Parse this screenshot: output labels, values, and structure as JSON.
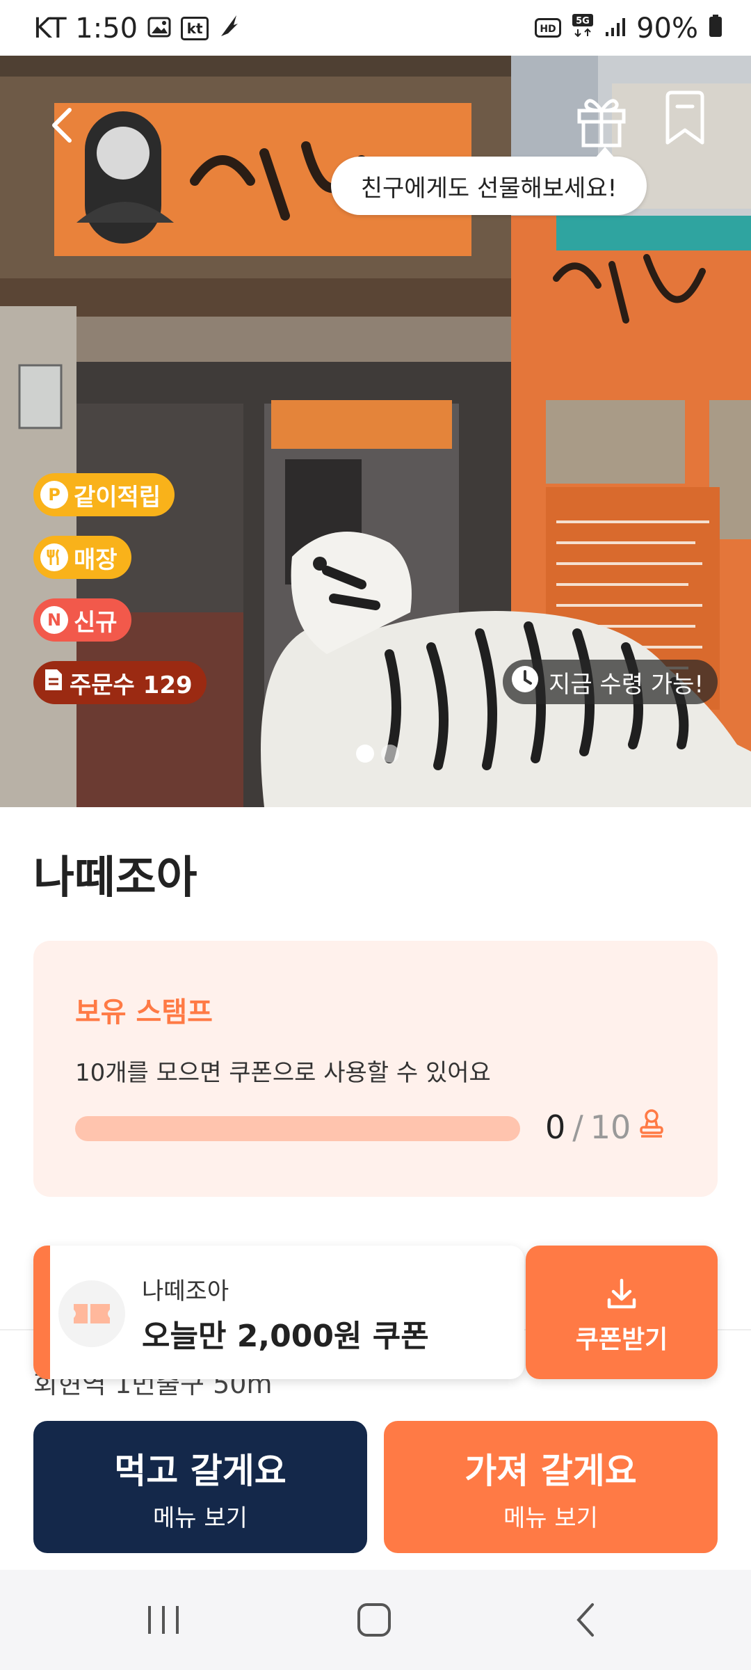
{
  "status_bar": {
    "carrier_time": "KT 1:50",
    "kt_badge": "kt",
    "battery": "90%",
    "icons": [
      "image-icon",
      "kt-icon",
      "feather-icon",
      "hd-icon",
      "5g-icon",
      "signal-icon",
      "battery-icon"
    ]
  },
  "hero": {
    "tooltip": "친구에게도 선물해보세요!",
    "chips": {
      "pickup": "같이적립",
      "store": "매장",
      "new": "신규",
      "orders": "주문수 129"
    },
    "chip_icons": {
      "pickup": "P",
      "new": "N"
    },
    "pickup_now": "지금 수령 가능!",
    "slide_index": 1,
    "slide_total": 2
  },
  "store": {
    "name": "나떼조아"
  },
  "stamp": {
    "heading": "보유 스탬프",
    "description": "10개를 모으면 쿠폰으로 사용할 수 있어요",
    "current": "0",
    "separator": "/",
    "total": "10",
    "progress": 0
  },
  "coupon": {
    "store_name": "나떼조아",
    "title": "오늘만 2,000원 쿠폰",
    "button_label": "쿠폰받기"
  },
  "distance_text": "회현역 1번출구 50m",
  "actions": {
    "eat_in": {
      "label": "먹고 갈게요",
      "sub": "메뉴 보기"
    },
    "take_out": {
      "label": "가져 갈게요",
      "sub": "메뉴 보기"
    }
  },
  "colors": {
    "accent": "#ff7a45",
    "navy": "#14284a",
    "stamp_bg": "#fff1ec"
  }
}
